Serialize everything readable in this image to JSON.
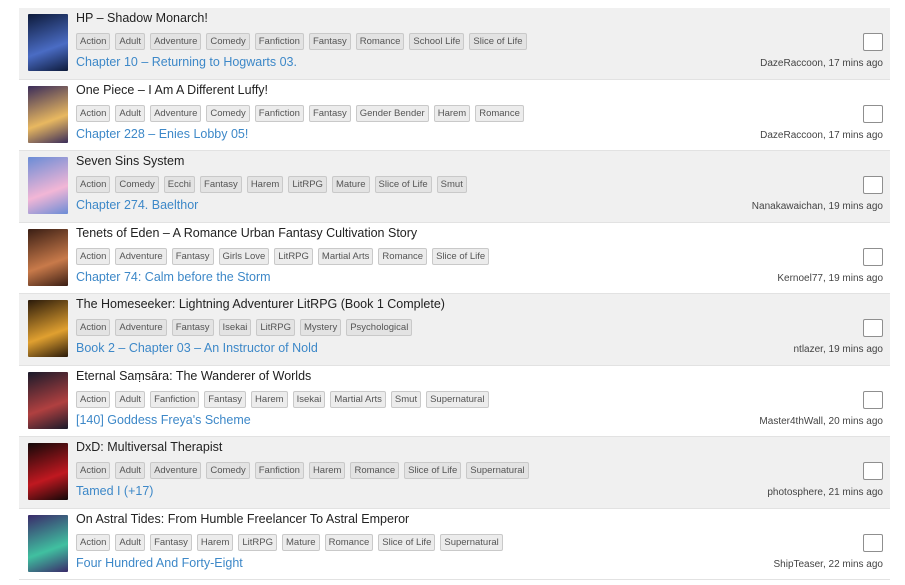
{
  "updates": [
    {
      "title": "HP – Shadow Monarch!",
      "tags": [
        "Action",
        "Adult",
        "Adventure",
        "Comedy",
        "Fanfiction",
        "Fantasy",
        "Romance",
        "School Life",
        "Slice of Life"
      ],
      "chapter": "Chapter 10 – Returning to Hogwarts 03.",
      "meta": "DazeRaccoon, 17 mins ago",
      "cover_colors": [
        "#0d1a3a",
        "#4a6cc4"
      ]
    },
    {
      "title": "One Piece – I Am A Different Luffy!",
      "tags": [
        "Action",
        "Adult",
        "Adventure",
        "Comedy",
        "Fanfiction",
        "Fantasy",
        "Gender Bender",
        "Harem",
        "Romance"
      ],
      "chapter": "Chapter 228 – Enies Lobby 05!",
      "meta": "DazeRaccoon, 17 mins ago",
      "cover_colors": [
        "#3a2c5a",
        "#e8b860"
      ]
    },
    {
      "title": "Seven Sins System",
      "tags": [
        "Action",
        "Comedy",
        "Ecchi",
        "Fantasy",
        "Harem",
        "LitRPG",
        "Mature",
        "Slice of Life",
        "Smut"
      ],
      "chapter": "Chapter 274. Baelthor",
      "meta": "Nanakawaichan, 19 mins ago",
      "cover_colors": [
        "#6a8cd6",
        "#f2b6d6"
      ]
    },
    {
      "title": "Tenets of Eden – A Romance Urban Fantasy Cultivation Story",
      "tags": [
        "Action",
        "Adventure",
        "Fantasy",
        "Girls Love",
        "LitRPG",
        "Martial Arts",
        "Romance",
        "Slice of Life"
      ],
      "chapter": "Chapter 74: Calm before the Storm",
      "meta": "Kernoel77, 19 mins ago",
      "cover_colors": [
        "#3a1e14",
        "#c87a4a"
      ]
    },
    {
      "title": "The Homeseeker: Lightning Adventurer LitRPG (Book 1 Complete)",
      "tags": [
        "Action",
        "Adventure",
        "Fantasy",
        "Isekai",
        "LitRPG",
        "Mystery",
        "Psychological"
      ],
      "chapter": "Book 2 – Chapter 03 – An Instructor of Nold",
      "meta": "ntlazer, 19 mins ago",
      "cover_colors": [
        "#2a1a0a",
        "#e0a030"
      ]
    },
    {
      "title": "Eternal Saṃsāra: The Wanderer of Worlds",
      "tags": [
        "Action",
        "Adult",
        "Fanfiction",
        "Fantasy",
        "Harem",
        "Isekai",
        "Martial Arts",
        "Smut",
        "Supernatural"
      ],
      "chapter": "[140] Goddess Freya's Scheme",
      "meta": "Master4thWall, 20 mins ago",
      "cover_colors": [
        "#1a1a2a",
        "#b04040"
      ]
    },
    {
      "title": "DxD: Multiversal Therapist",
      "tags": [
        "Action",
        "Adult",
        "Adventure",
        "Comedy",
        "Fanfiction",
        "Harem",
        "Romance",
        "Slice of Life",
        "Supernatural"
      ],
      "chapter": "Tamed I (+17)",
      "meta": "photosphere, 21 mins ago",
      "cover_colors": [
        "#120808",
        "#c01820"
      ]
    },
    {
      "title": "On Astral Tides: From Humble Freelancer To Astral Emperor",
      "tags": [
        "Action",
        "Adult",
        "Fantasy",
        "Harem",
        "LitRPG",
        "Mature",
        "Romance",
        "Slice of Life",
        "Supernatural"
      ],
      "chapter": "Four Hundred And Forty-Eight",
      "meta": "ShipTeaser, 22 mins ago",
      "cover_colors": [
        "#3a2a6a",
        "#40c0a0"
      ]
    }
  ]
}
